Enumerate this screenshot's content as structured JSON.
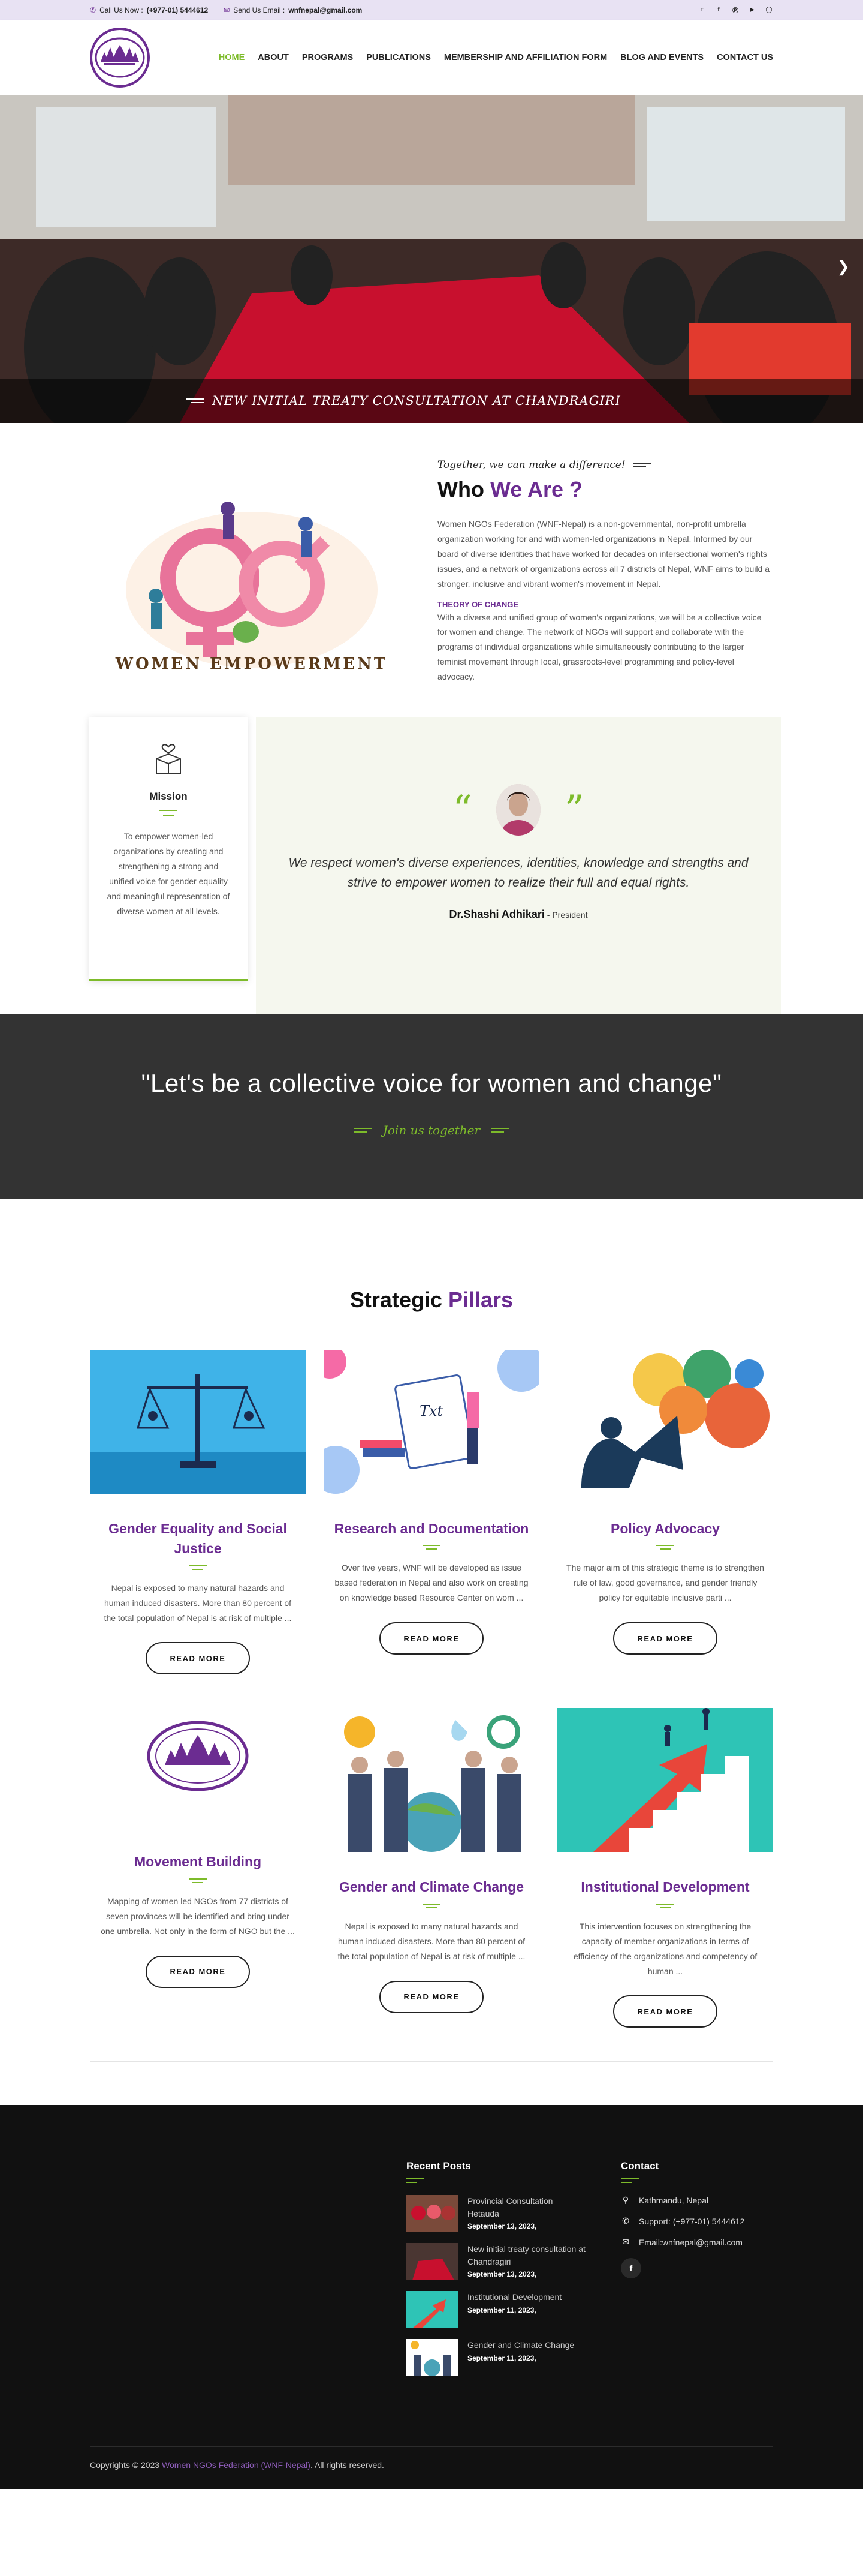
{
  "topbar": {
    "call_label": "Call Us Now :",
    "call_number": "(+977-01) 5444612",
    "email_label": "Send Us Email :",
    "email_value": "wnfnepal@gmail.com",
    "social_icons": [
      "twitter-icon",
      "facebook-icon",
      "pinterest-icon",
      "youtube-icon",
      "instagram-icon"
    ]
  },
  "nav": {
    "items": [
      "HOME",
      "ABOUT",
      "PROGRAMS",
      "PUBLICATIONS",
      "MEMBERSHIP AND AFFILIATION FORM",
      "BLOG AND EVENTS",
      "CONTACT US"
    ],
    "active": "HOME"
  },
  "hero": {
    "caption": "NEW INITIAL TREATY CONSULTATION AT CHANDRAGIRI"
  },
  "who": {
    "tagline": "Together, we can make a difference!",
    "title_a": "Who",
    "title_b": "We Are ?",
    "image_text": "WOMEN EMPOWERMENT",
    "para1": "Women NGOs Federation (WNF-Nepal) is a non-governmental, non-profit umbrella organization working for and with women-led organizations in Nepal. Informed by our board of diverse identities that have worked for decades on intersectional women's rights issues, and a network of organizations across all 7 districts of Nepal, WNF aims to build a stronger, inclusive and vibrant women's movement in Nepal.",
    "toc_heading": "THEORY OF CHANGE",
    "para2": "With a diverse and unified group of women's organizations, we will be a collective voice for women and change. The network of NGOs will support and collaborate with the programs of individual organizations while simultaneously contributing to the larger feminist movement through local, grassroots-level programming and policy-level advocacy."
  },
  "mission": {
    "title": "Mission",
    "text": "To empower women-led organizations by creating and strengthening a strong and unified voice for gender equality and meaningful representation of diverse women at all levels."
  },
  "quote": {
    "open_mark": "“",
    "close_mark": "”",
    "text": "We respect women's diverse experiences, identities, knowledge and strengths and strive to empower women to realize their full and equal rights.",
    "author": "Dr.Shashi Adhikari",
    "role": "- President"
  },
  "banner": {
    "heading": "\"Let's be a collective voice for women and change\"",
    "cta": "Join us together"
  },
  "pillars": {
    "title_a": "Strategic",
    "title_b": "Pillars",
    "read_more": "READ MORE",
    "cards": [
      {
        "title": "Gender Equality and Social Justice",
        "text": "Nepal is exposed to many natural hazards and human induced disasters. More than 80 percent of the total population of Nepal is at risk of multiple ..."
      },
      {
        "title": "Research and Documentation",
        "text": "Over five years, WNF will be developed as issue based federation in Nepal and also work on creating on knowledge based Resource Center on wom ..."
      },
      {
        "title": "Policy Advocacy",
        "text": "The major aim of this strategic theme is to strengthen rule of law, good governance, and gender friendly policy for equitable inclusive parti ..."
      },
      {
        "title": "Movement Building",
        "text": "Mapping of women led NGOs from 77 districts of seven provinces will be identified and bring under one umbrella. Not only in the form of NGO but the ..."
      },
      {
        "title": "Gender and Climate Change",
        "text": "Nepal is exposed to many natural hazards and human induced disasters. More than 80 percent of the total population of Nepal is at risk of multiple ..."
      },
      {
        "title": "Institutional Development",
        "text": "This intervention focuses on strengthening the capacity of member organizations in terms of efficiency of the organizations and competency of human ..."
      }
    ]
  },
  "footer": {
    "recent_title": "Recent Posts",
    "posts": [
      {
        "title": "Provincial Consultation Hetauda",
        "date": "September 13, 2023,"
      },
      {
        "title": "New initial treaty consultation at Chandragiri",
        "date": "September 13, 2023,"
      },
      {
        "title": "Institutional Development",
        "date": "September 11, 2023,"
      },
      {
        "title": "Gender and Climate Change",
        "date": "September 11, 2023,"
      }
    ],
    "contact_title": "Contact",
    "address": "Kathmandu, Nepal",
    "support": "Support: (+977-01) 5444612",
    "email": "Email:wnfnepal@gmail.com",
    "facebook": "f",
    "copy_pre": "Copyrights © 2023",
    "copy_org": "Women NGOs Federation (WNF-Nepal)",
    "copy_post": ". All rights reserved."
  },
  "colors": {
    "brand": "#6b2c91",
    "accent": "#7dbb2a",
    "dark": "#111111",
    "banner": "#333333"
  }
}
